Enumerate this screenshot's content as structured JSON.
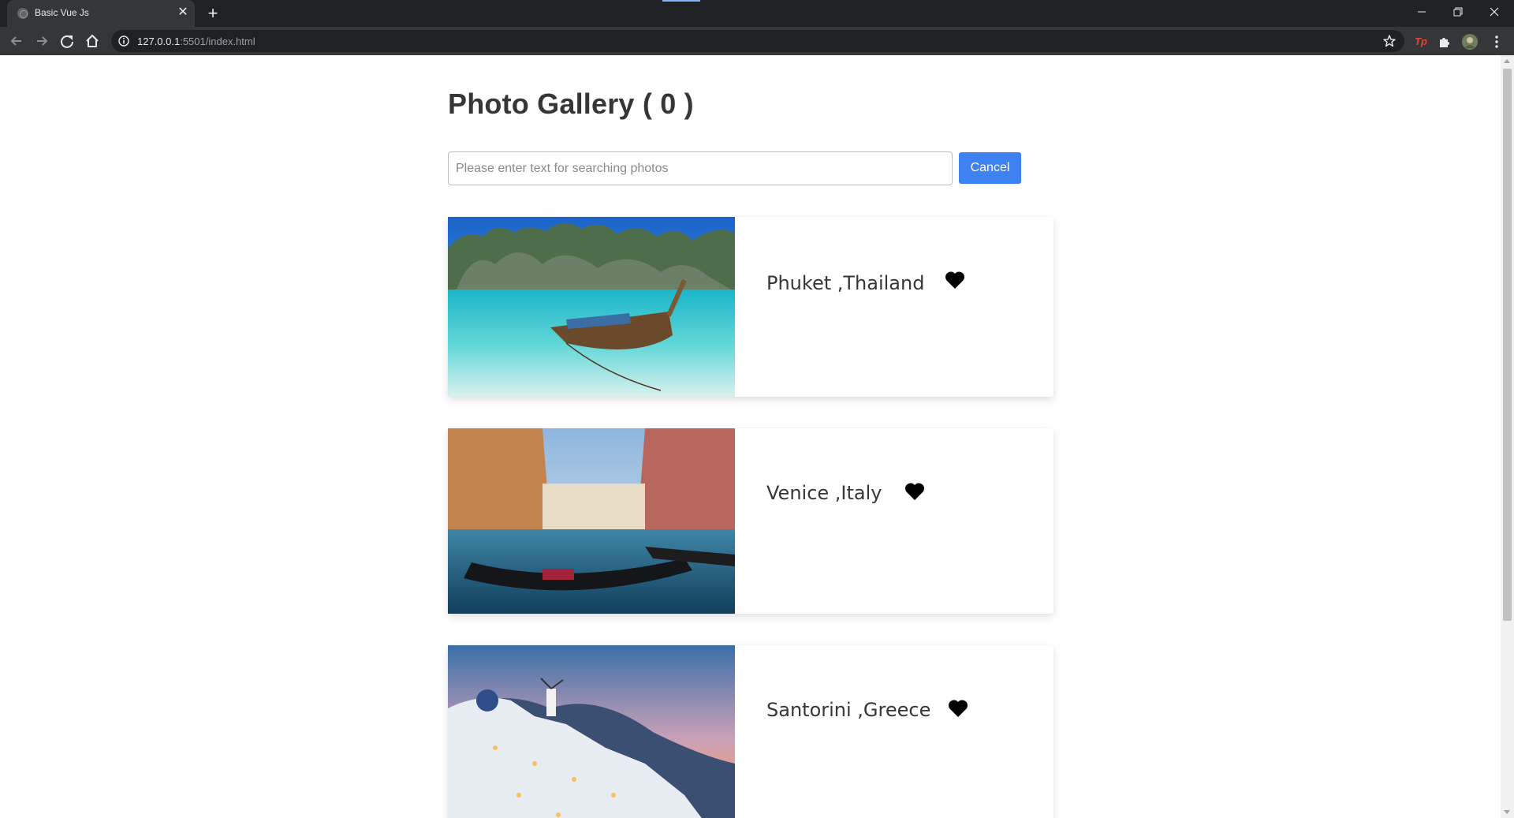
{
  "browser": {
    "tab_title": "Basic Vue Js",
    "url_host": "127.0.0.1",
    "url_rest": ":5501/index.html",
    "extension_tp_label": "Tp"
  },
  "page": {
    "title": "Photo Gallery ( 0 )",
    "search": {
      "placeholder": "Please enter text for searching photos",
      "value": ""
    },
    "cancel_label": "Cancel",
    "photos": [
      {
        "place": "Phuket ,Thailand",
        "liked": true
      },
      {
        "place": "Venice ,Italy",
        "liked": true
      },
      {
        "place": "Santorini ,Greece",
        "liked": true
      }
    ]
  },
  "colors": {
    "accent": "#3d82f0",
    "title_text": "#363636",
    "chrome_dark": "#202124",
    "chrome_toolbar": "#35363a"
  },
  "icons": [
    "back-icon",
    "forward-icon",
    "reload-icon",
    "home-icon",
    "info-icon",
    "star-icon",
    "puzzle-icon",
    "menu-icon",
    "heart-icon"
  ]
}
